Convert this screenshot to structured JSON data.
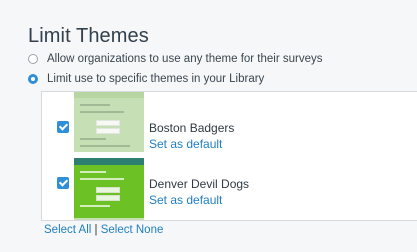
{
  "title": "Limit Themes",
  "options": {
    "any_label": "Allow organizations to use any theme for their surveys",
    "limit_label": "Limit use to specific themes in your Library",
    "selected": "limit"
  },
  "themes": [
    {
      "name": "Boston Badgers",
      "action": "Set as default",
      "checked": true,
      "thumb_color": "#c7dfb4"
    },
    {
      "name": "Denver Devil Dogs",
      "action": "Set as default",
      "checked": true,
      "thumb_color": "#6cc224"
    }
  ],
  "footer": {
    "select_all": "Select All",
    "separator": "|",
    "select_none": "Select None"
  },
  "colors": {
    "accent": "#2f8fd9",
    "link": "#1f7fc0"
  }
}
